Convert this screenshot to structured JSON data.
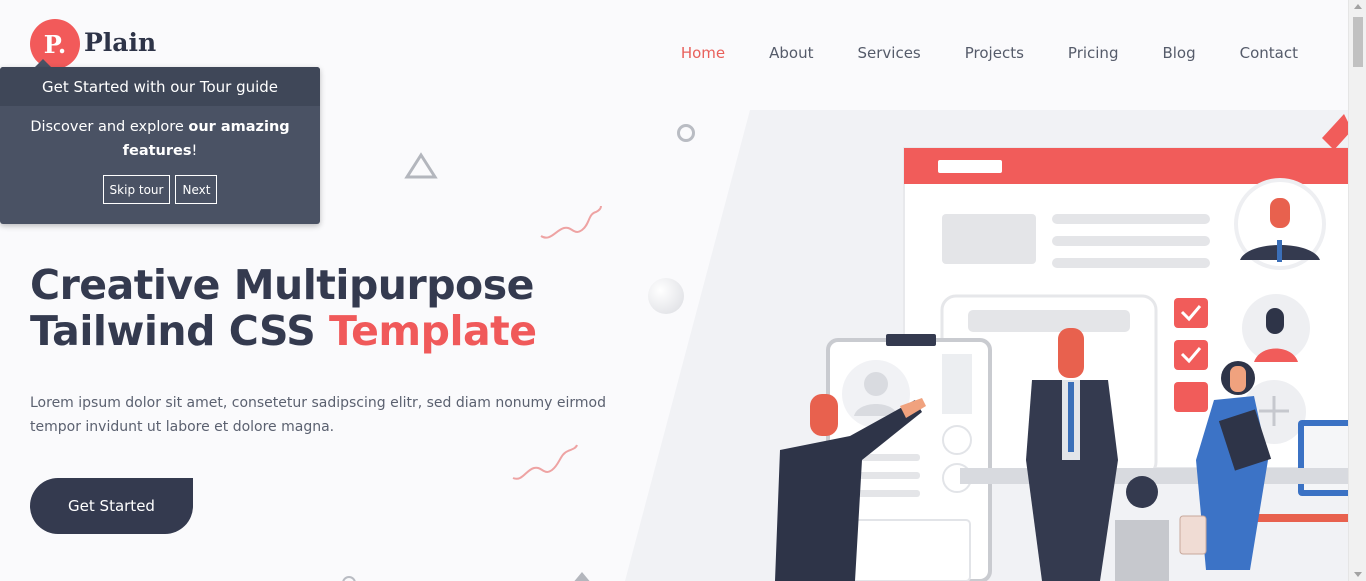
{
  "logo": {
    "badge": "P.",
    "name": "Plain"
  },
  "nav": {
    "items": [
      {
        "label": "Home",
        "active": true
      },
      {
        "label": "About",
        "active": false
      },
      {
        "label": "Services",
        "active": false
      },
      {
        "label": "Projects",
        "active": false
      },
      {
        "label": "Pricing",
        "active": false
      },
      {
        "label": "Blog",
        "active": false
      },
      {
        "label": "Contact",
        "active": false
      }
    ]
  },
  "tour": {
    "title": "Get Started with our Tour guide",
    "body_plain": "Discover and explore ",
    "body_bold": "our amazing features",
    "body_end": "!",
    "skip_label": "Skip tour",
    "next_label": "Next"
  },
  "hero": {
    "title_line1": "Creative Multipurpose",
    "title_line2_plain": "Tailwind CSS ",
    "title_line2_accent": "Template",
    "description": "Lorem ipsum dolor sit amet, consetetur sadipscing elitr, sed diam nonumy eirmod tempor invidunt ut labore et dolore magna.",
    "cta_label": "Get Started"
  },
  "colors": {
    "accent": "#f0595a",
    "dark": "#343a4f",
    "tour_bg": "#4a5264",
    "nav_active": "#e8605b"
  }
}
